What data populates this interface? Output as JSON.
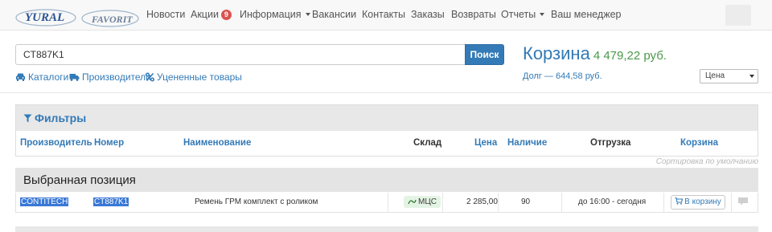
{
  "brand": {
    "logo_primary": "YURAL",
    "logo_secondary": "FAVORIT"
  },
  "nav": {
    "items": [
      {
        "label": "Новости",
        "dropdown": false
      },
      {
        "label": "Акции",
        "badge": "9",
        "dropdown": false
      },
      {
        "label": "Информация",
        "dropdown": true
      },
      {
        "label": "Вакансии",
        "dropdown": false
      },
      {
        "label": "Контакты",
        "dropdown": false
      },
      {
        "label": "Заказы",
        "dropdown": false
      },
      {
        "label": "Возвраты",
        "dropdown": false
      },
      {
        "label": "Отчеты",
        "dropdown": true
      },
      {
        "label": "Ваш менеджер",
        "dropdown": false
      }
    ]
  },
  "search": {
    "value": "CT887K1",
    "button_label": "Поиск"
  },
  "quick_links": [
    {
      "label": "Каталоги",
      "icon": "car-icon"
    },
    {
      "label": "Производители",
      "icon": "truck-icon"
    },
    {
      "label": "Уцененные товары",
      "icon": "percent-icon"
    }
  ],
  "cart": {
    "title": "Корзина",
    "sum": "4 479,22 руб.",
    "debt": "Долг — 644,58 руб."
  },
  "sort": {
    "selected": "Цена"
  },
  "filters": {
    "title": "Фильтры",
    "icon": "filter-icon"
  },
  "columns": {
    "manufacturer": "Производитель",
    "number": "Номер",
    "name": "Наименование",
    "warehouse": "Склад",
    "price": "Цена",
    "availability": "Наличие",
    "shipment": "Отгрузка",
    "cart": "Корзина"
  },
  "sort_note": "Сортировка по умолчанию",
  "selected_section": {
    "title": "Выбранная позиция"
  },
  "selected_row": {
    "manufacturer": "CONTITECH",
    "number": "CT887K1",
    "name": "Ремень ГРМ комплект с роликом",
    "warehouse": "МЦС",
    "price": "2 285,00",
    "availability": "90",
    "shipment": "до 16:00 - сегодня",
    "cart_button": "В корзину"
  },
  "colors": {
    "accent": "#337ab7",
    "cart_sum": "#4a9a4a",
    "badge": "#d9534f",
    "highlight": "#3a78d6"
  }
}
